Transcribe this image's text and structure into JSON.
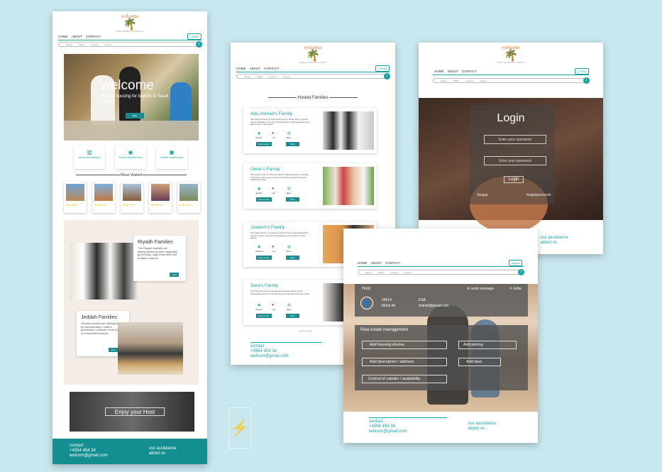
{
  "logo": {
    "word": "welcome",
    "palm": "🌴",
    "tag": "FAMILY ROOMS FOR TOURISTS"
  },
  "nav": {
    "home": "HOME",
    "about": "ABOUT",
    "contact": "CONTACT",
    "login": "LOGIN",
    "logout": "logout"
  },
  "search": {
    "items": [
      "Places",
      "Which",
      "Leaving",
      "Guests"
    ]
  },
  "home": {
    "hero_title": "welcome",
    "hero_sub": "Family housing for tourists in Saudi Arabia",
    "hero_btn": "join",
    "features": [
      "Accommodations",
      "Travel experiences",
      "Online experience"
    ],
    "most_visited": "Most Visited",
    "stars": "★★★★☆",
    "riyadh": {
      "title": "Riyadh Families",
      "text": "The Riyadh families are distinguished by their originality, generosity, rapprochement and multiple cultures",
      "btn": "more"
    },
    "jeddah": {
      "title": "Jeddah Families",
      "text": "Jeddah families are distinguished by sophistication, culture, generosity, multitude of services and beautiful seafood",
      "btn": "more"
    },
    "enjoy": "Enjoy your Host",
    "footer": {
      "contact": "contact",
      "phone": "+4554 454 34",
      "email": "welcom@gmail.com",
      "assistance": "our assistance",
      "about": "about us"
    }
  },
  "hosted": {
    "heading": "Hosted Families",
    "families": [
      {
        "name": "Abu Ahmad's Family",
        "text": "Abu Ahmad Family is distinguished as a family with a special Saudi character in the city of Riyadh and is distinguished by its generosity to the guests",
        "loc": "Riyadh",
        "likes": "+1k",
        "price": "$free"
      },
      {
        "name": "Omar's Family",
        "text": "The Omar family is a friendly family characterized by a variety of services and meets a travel enchanting the Red Sea and traditional meals",
        "loc": "Jeddah",
        "likes": "+2k",
        "price": "$free"
      },
      {
        "name": "Jaseem's Family",
        "text": "The Jasim family is a generous family that is distinguished for its Arab culture, historical knowledge and the honor of their guests",
        "loc": "Dhahran",
        "likes": "+1k",
        "price": "$free"
      },
      {
        "name": "Sara's Family",
        "text": "The Sara family is an elegant and genuine family that is distinguished for its foods offering cultural skills and generosity",
        "loc": "Tabouk",
        "likes": "+1k",
        "price": "$free"
      }
    ],
    "book_btn": "book a host",
    "more_btn": "More"
  },
  "login": {
    "title": "Login",
    "username_ph": "Enter your username",
    "password_ph": "Enter your password",
    "btn": "Login",
    "signup": "Singup",
    "forget": "forgetpassword"
  },
  "host": {
    "label": "Host",
    "send": "send message",
    "edit": "Edite",
    "id": "34514",
    "name": "Mohs Ali",
    "country": "KSA",
    "email": "mahali@gmail.com",
    "real_estate": "Real estate management",
    "actions": [
      "Add housing photos",
      "Add pricing",
      "Add description / address",
      "Add laws",
      "Control of caleder / avaliability"
    ]
  },
  "colors": {
    "teal": "#18a3a3",
    "bg": "#c9e7ee",
    "orange": "#e07b2a"
  }
}
